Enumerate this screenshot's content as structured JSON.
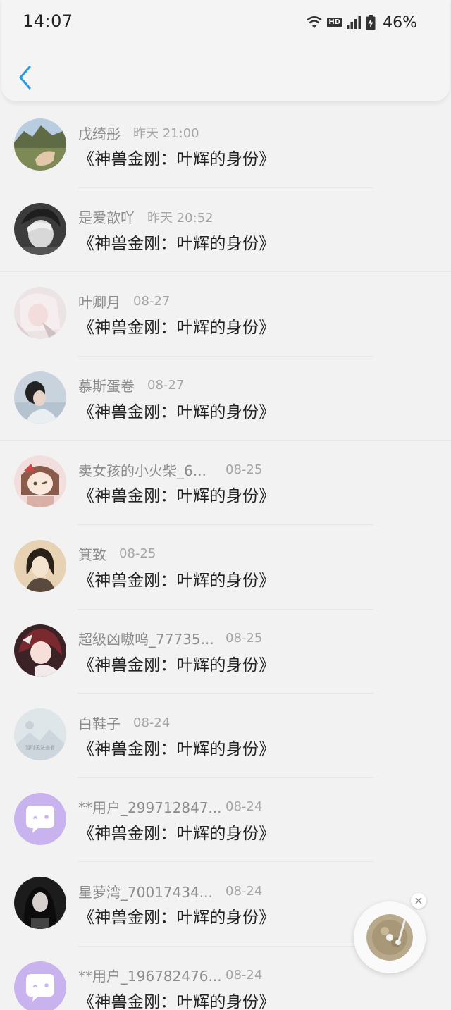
{
  "status_bar": {
    "time": "14:07",
    "hd_label": "HD",
    "battery_percent": "46%"
  },
  "header": {
    "back_icon": "chevron-left-icon"
  },
  "comments": [
    {
      "name": "戊绮彤",
      "time": "昨天 21:00",
      "message": "《神兽金刚：叶辉的身份》",
      "avatar": "landscape-photo"
    },
    {
      "name": "是爱歆吖",
      "time": "昨天 20:52",
      "message": "《神兽金刚：叶辉的身份》",
      "avatar": "anime-boy"
    },
    {
      "name": "叶卿月",
      "time": "08-27",
      "message": "《神兽金刚：叶辉的身份》",
      "avatar": "pale-anime-girl"
    },
    {
      "name": "慕斯蛋卷",
      "time": "08-27",
      "message": "《神兽金刚：叶辉的身份》",
      "avatar": "girl-photo"
    },
    {
      "name": "卖女孩的小火柴_6...",
      "time": "08-25",
      "message": "《神兽金刚：叶辉的身份》",
      "avatar": "chibi-girl"
    },
    {
      "name": "箕致",
      "time": "08-25",
      "message": "《神兽金刚：叶辉的身份》",
      "avatar": "sketch-girl"
    },
    {
      "name": "超级凶嗷呜_77735...",
      "time": "08-25",
      "message": "《神兽金刚：叶辉的身份》",
      "avatar": "red-anime-girl"
    },
    {
      "name": "白鞋子",
      "time": "08-24",
      "message": "《神兽金刚：叶辉的身份》",
      "avatar": "image-unavailable",
      "avatar_text": "暂时无法查看"
    },
    {
      "name": "**用户_299712847...",
      "time": "08-24",
      "message": "《神兽金刚：叶辉的身份》",
      "avatar": "default-chat-bubble"
    },
    {
      "name": "星萝湾_70017434...",
      "time": "08-24",
      "message": "《神兽金刚：叶辉的身份》",
      "avatar": "dark-photo"
    },
    {
      "name": "**用户_196782476...",
      "time": "08-24",
      "message": "《神兽金刚：叶辉的身份》",
      "avatar": "default-chat-bubble"
    }
  ],
  "float_player": {
    "close_label": "×",
    "icon": "music-disc-icon"
  },
  "colors": {
    "background": "#f2f2f2",
    "back_arrow": "#2a9ae3",
    "name_text": "#8c8c8c",
    "time_text": "#a5a5a5",
    "message_text": "#222222",
    "default_avatar": "#c9b3ee"
  }
}
